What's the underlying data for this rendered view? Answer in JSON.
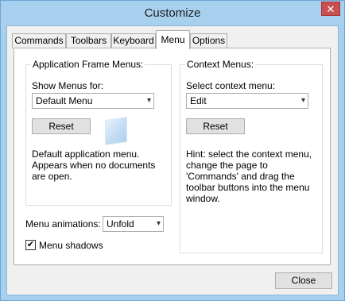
{
  "window": {
    "title": "Customize",
    "close_glyph": "✕"
  },
  "tabs": [
    {
      "label": "Commands"
    },
    {
      "label": "Toolbars"
    },
    {
      "label": "Keyboard"
    },
    {
      "label": "Menu"
    },
    {
      "label": "Options"
    }
  ],
  "active_tab": "Menu",
  "app_frame_menus": {
    "caption": "Application Frame Menus:",
    "show_menus_label": "Show Menus for:",
    "show_menus_value": "Default Menu",
    "reset_label": "Reset",
    "description": "Default application menu. Appears when no documents are open."
  },
  "context_menus": {
    "caption": "Context Menus:",
    "select_label": "Select context menu:",
    "select_value": "Edit",
    "reset_label": "Reset",
    "hint": "Hint: select the context menu, change the page to 'Commands' and drag the toolbar buttons into the menu window."
  },
  "menu_animations": {
    "label": "Menu animations:",
    "value": "Unfold"
  },
  "menu_shadows": {
    "label": "Menu shadows",
    "checked": true,
    "check_glyph": "✔"
  },
  "footer": {
    "close_label": "Close"
  },
  "icons": {
    "dropdown_arrow": "▾"
  }
}
